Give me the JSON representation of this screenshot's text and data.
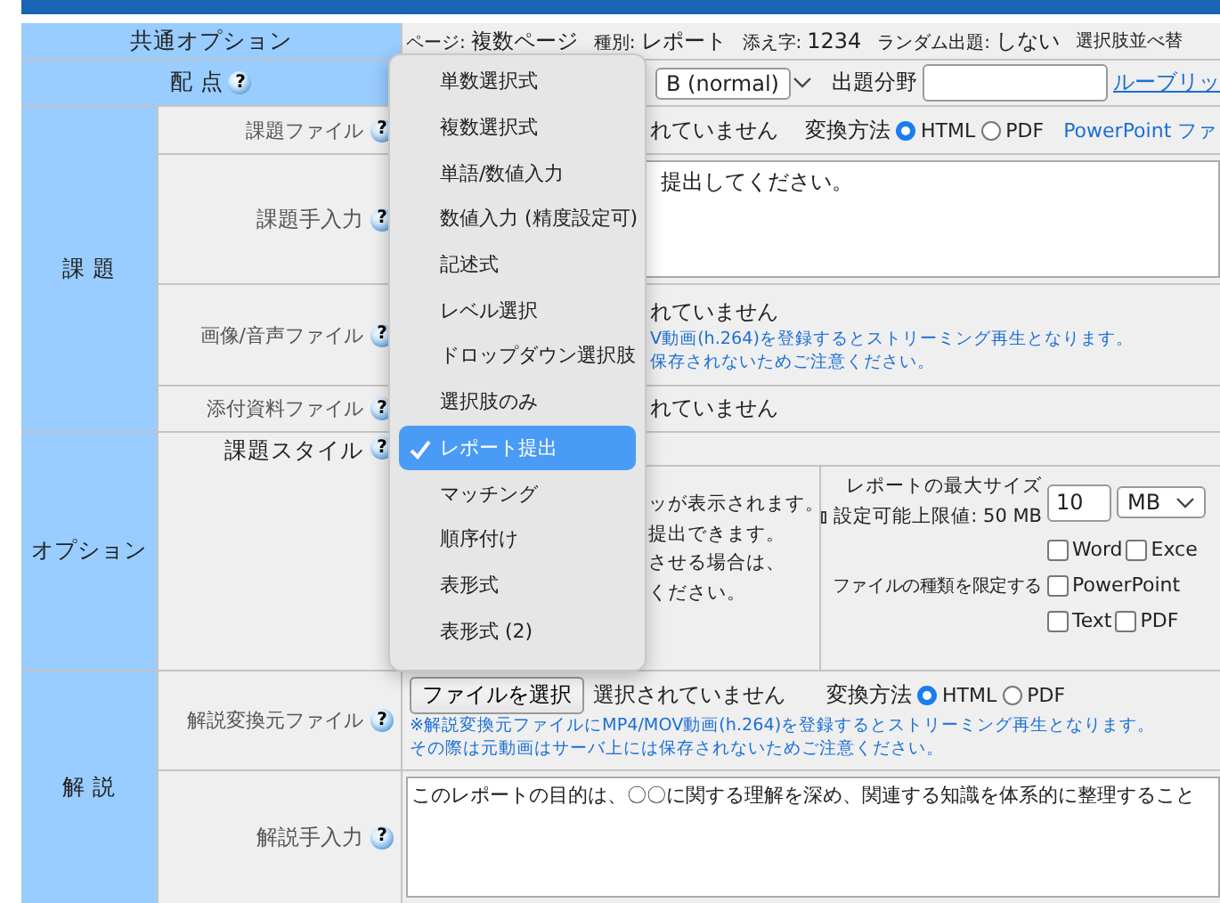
{
  "common_options": {
    "label": "共通オプション",
    "items": [
      {
        "label": "ページ:",
        "value": "複数ページ"
      },
      {
        "label": "種別:",
        "value": "レポート"
      },
      {
        "label": "添え字:",
        "value": "1234"
      },
      {
        "label": "ランダム出題:",
        "value": "しない"
      },
      {
        "label": "選択肢並べ替"
      }
    ]
  },
  "points": {
    "label": "配 点",
    "help": "?",
    "grade": "B (normal)",
    "field_label": "出題分野",
    "rubric_link": "ルーブリッ"
  },
  "task": {
    "label": "課 題",
    "rows": [
      {
        "kind": "file",
        "label": "課題ファイル",
        "help": "?",
        "status": "れていません",
        "convert_label": "変換方法",
        "formats": [
          {
            "label": "HTML",
            "selected": true
          },
          {
            "label": "PDF",
            "selected": false
          }
        ],
        "link": "PowerPoint ファ"
      },
      {
        "kind": "text",
        "label": "課題手入力",
        "help": "?",
        "text": "提出してください。"
      },
      {
        "kind": "file",
        "label": "画像/音声ファイル",
        "help": "?",
        "status": "れていません",
        "notes": [
          "V動画(h.264)を登録するとストリーミング再生となります。",
          "保存されないためご注意ください。"
        ]
      },
      {
        "kind": "file",
        "label": "添付資料ファイル",
        "help": "?",
        "status": "れていません"
      }
    ]
  },
  "options": {
    "label": "オプション",
    "style_label": "課題スタイル",
    "help": "?",
    "description": [
      "ッが表示されます。",
      "提出できます。",
      "させる場合は、",
      "ください。"
    ],
    "max_size_label": "レポートの最大サイズ",
    "limit_note": "設定可能上限値: 50 MB",
    "size": "10",
    "unit": "MB",
    "types_label": "ファイルの種類を限定する",
    "types": [
      {
        "label": "Word",
        "checked": false
      },
      {
        "label": "Exce",
        "checked": false
      },
      {
        "label": "PowerPoint",
        "checked": false
      },
      {
        "label": "Text",
        "checked": false
      },
      {
        "label": "PDF",
        "checked": false
      }
    ]
  },
  "explanation": {
    "label": "解 説",
    "rows": [
      {
        "kind": "file",
        "label": "解説変換元ファイル",
        "help": "?",
        "button": "ファイルを選択",
        "status": "選択されていません",
        "convert_label": "変換方法",
        "formats": [
          {
            "label": "HTML",
            "selected": true
          },
          {
            "label": "PDF",
            "selected": false
          }
        ],
        "notes": [
          "※解説変換元ファイルにMP4/MOV動画(h.264)を登録するとストリーミング再生となります。",
          "その際は元動画はサーバ上には保存されないためご注意ください。"
        ]
      },
      {
        "kind": "text",
        "label": "解説手入力",
        "help": "?",
        "text": "このレポートの目的は、〇〇に関する理解を深め、関連する知識を体系的に整理すること"
      }
    ]
  },
  "menu": {
    "items": [
      {
        "label": "単数選択式",
        "selected": false
      },
      {
        "label": "複数選択式",
        "selected": false
      },
      {
        "label": "単語/数値入力",
        "selected": false
      },
      {
        "label": "数値入力 (精度設定可)",
        "selected": false
      },
      {
        "label": "記述式",
        "selected": false
      },
      {
        "label": "レベル選択",
        "selected": false
      },
      {
        "label": "ドロップダウン選択肢",
        "selected": false
      },
      {
        "label": "選択肢のみ",
        "selected": false
      },
      {
        "label": "レポート提出",
        "selected": true
      },
      {
        "label": "マッチング",
        "selected": false
      },
      {
        "label": "順序付け",
        "selected": false
      },
      {
        "label": "表形式",
        "selected": false
      },
      {
        "label": "表形式 (2)",
        "selected": false
      }
    ]
  }
}
